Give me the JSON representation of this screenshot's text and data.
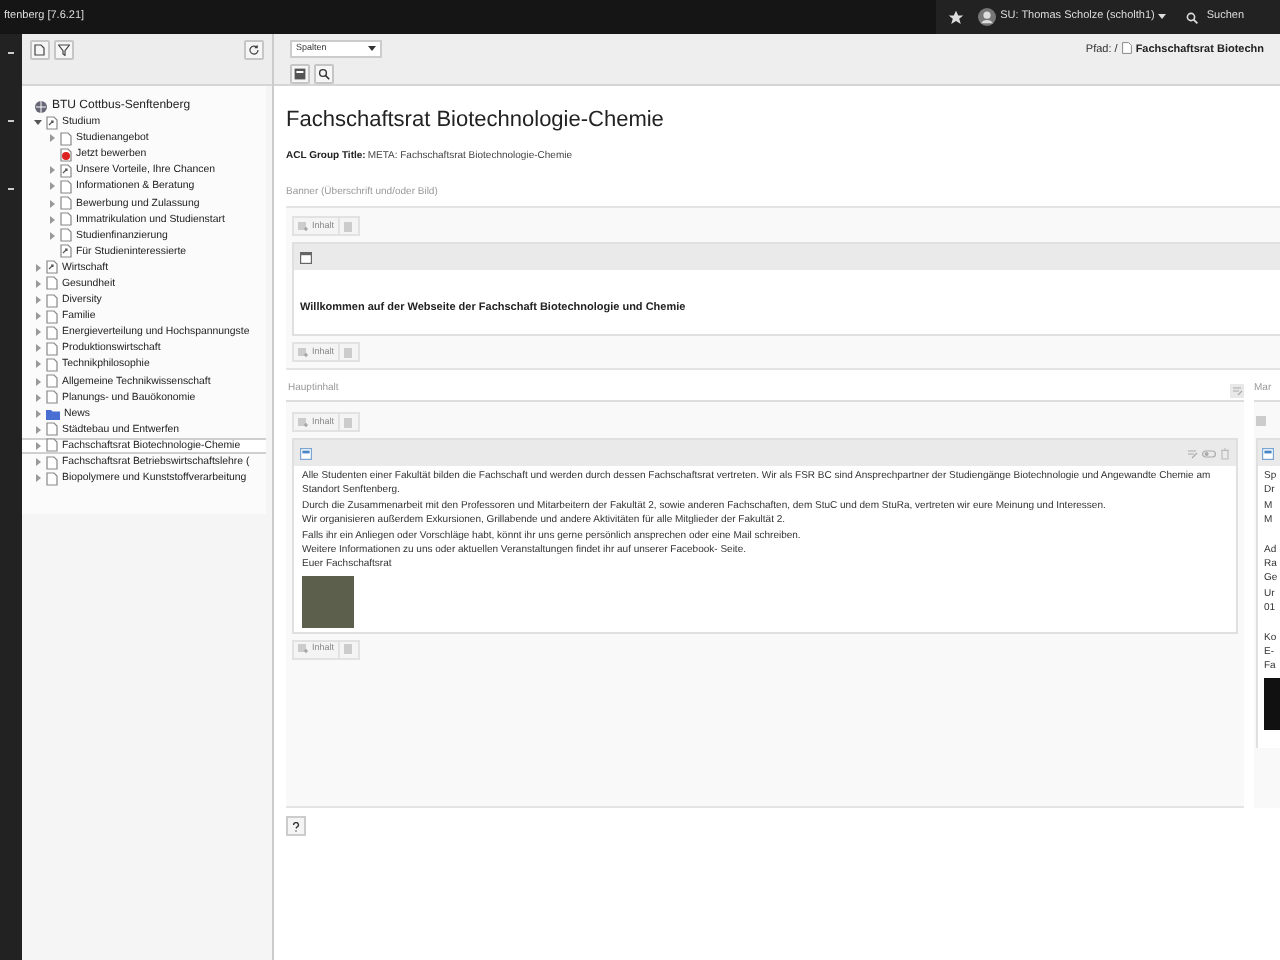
{
  "topbar": {
    "title": "ftenberg [7.6.21]",
    "user": "SU: Thomas Scholze (scholth1)",
    "search": "Suchen"
  },
  "tree": {
    "root": "BTU Cottbus-Senftenberg",
    "items": [
      {
        "label": "Studium",
        "kind": "shortcut",
        "expanded": true,
        "selected": false,
        "children": [
          {
            "label": "Studienangebot",
            "kind": "page",
            "expanded": false,
            "selected": false
          },
          {
            "label": "Jetzt bewerben",
            "kind": "link",
            "selected": false
          },
          {
            "label": "Unsere Vorteile, Ihre Chancen",
            "kind": "shortcut",
            "expanded": false,
            "selected": false
          },
          {
            "label": "Informationen & Beratung",
            "kind": "page",
            "expanded": false,
            "selected": false
          },
          {
            "label": "Bewerbung und Zulassung",
            "kind": "page",
            "expanded": false,
            "selected": false
          },
          {
            "label": "Immatrikulation und Studienstart",
            "kind": "page",
            "expanded": false,
            "selected": false
          },
          {
            "label": "Studienfinanzierung",
            "kind": "page",
            "expanded": false,
            "selected": false
          },
          {
            "label": "Für Studieninteressierte",
            "kind": "shortcut",
            "selected": false
          }
        ]
      },
      {
        "label": "Wirtschaft",
        "kind": "shortcut",
        "expanded": false,
        "selected": false
      },
      {
        "label": "Gesundheit",
        "kind": "page",
        "expanded": false,
        "selected": false
      },
      {
        "label": "Diversity",
        "kind": "page",
        "expanded": false,
        "selected": false
      },
      {
        "label": "Familie",
        "kind": "page",
        "expanded": false,
        "selected": false
      },
      {
        "label": "Energieverteilung und Hochspannungste",
        "kind": "page",
        "expanded": false,
        "selected": false
      },
      {
        "label": "Produktionswirtschaft",
        "kind": "page",
        "expanded": false,
        "selected": false
      },
      {
        "label": "Technikphilosophie",
        "kind": "page",
        "expanded": false,
        "selected": false
      },
      {
        "label": "Allgemeine Technikwissenschaft",
        "kind": "page",
        "expanded": false,
        "selected": false
      },
      {
        "label": "Planungs- und Bauökonomie",
        "kind": "page",
        "expanded": false,
        "selected": false
      },
      {
        "label": "News",
        "kind": "folder",
        "expanded": false,
        "selected": false
      },
      {
        "label": "Städtebau und Entwerfen",
        "kind": "page",
        "expanded": false,
        "selected": false
      },
      {
        "label": "Fachschaftsrat Biotechnologie-Chemie",
        "kind": "page",
        "expanded": false,
        "selected": true
      },
      {
        "label": "Fachschaftsrat Betriebswirtschaftslehre (",
        "kind": "page",
        "expanded": false,
        "selected": false
      },
      {
        "label": "Biopolymere und Kunststoffverarbeitung",
        "kind": "page",
        "expanded": false,
        "selected": false
      }
    ]
  },
  "docheader": {
    "view_select": "Spalten",
    "path_label": "Pfad: /",
    "path_page": "Fachschaftsrat Biotechn"
  },
  "page": {
    "title": "Fachschaftsrat Biotechnologie-Chemie",
    "acl_label": "ACL Group Title:",
    "acl_value": "META: Fachschaftsrat Biotechnologie-Chemie",
    "banner": {
      "heading": "Banner (Überschrift und/oder Bild)",
      "add_label": "Inhalt",
      "element_text": "Willkommen auf der Webseite der Fachschaft Biotechnologie und Chemie",
      "add_label_2": "Inhalt"
    },
    "main": {
      "heading": "Hauptinhalt",
      "add_label": "Inhalt",
      "paragraphs": [
        "Alle Studenten einer Fakultät bilden die Fachschaft und werden durch dessen Fachschaftsrat vertreten. Wir als FSR BC sind Ansprechpartner der Studiengänge Biotechnologie und Angewandte Chemie am Standort Senftenberg.",
        "Durch die Zusammenarbeit mit den Professoren und Mitarbeitern der Fakultät 2, sowie anderen Fachschaften, dem StuC und dem StuRa, vertreten wir eure Meinung und Interessen.",
        "Wir organisieren außerdem Exkursionen, Grillabende und andere Aktivitäten für alle Mitglieder der Fakultät 2.",
        "Falls ihr ein Anliegen oder Vorschläge habt, könnt ihr uns gerne persönlich ansprechen oder eine Mail schreiben.",
        "Weitere Informationen zu uns oder aktuellen Veranstaltungen findet ihr auf unserer Facebook- Seite.",
        "Euer Fachschaftsrat"
      ],
      "add_label_2": "Inhalt"
    },
    "side": {
      "heading": "Mar",
      "lines_1": [
        "Sp",
        "Dr",
        "M",
        "M"
      ],
      "lines_2": [
        "Ad",
        "Ra",
        "Ge",
        "Ur",
        "01"
      ],
      "lines_3": [
        "Ko",
        "E-",
        "Fa"
      ]
    }
  }
}
